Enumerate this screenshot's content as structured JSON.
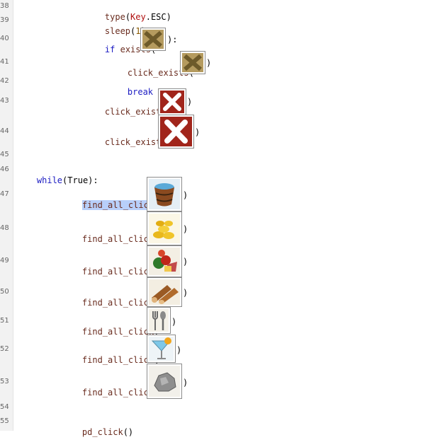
{
  "lines": [
    {
      "n": "38"
    },
    {
      "n": "39"
    },
    {
      "n": "40"
    },
    {
      "n": "41"
    },
    {
      "n": "42"
    },
    {
      "n": "43"
    },
    {
      "n": "44"
    },
    {
      "n": "45"
    },
    {
      "n": "46"
    },
    {
      "n": "47"
    },
    {
      "n": "48"
    },
    {
      "n": "49"
    },
    {
      "n": "50"
    },
    {
      "n": "51"
    },
    {
      "n": "52"
    },
    {
      "n": "53"
    },
    {
      "n": "54"
    },
    {
      "n": "55"
    }
  ],
  "code": {
    "l38": {
      "fn": "type",
      "arg1": "Key",
      "arg2": ".ESC"
    },
    "l39": {
      "fn": "sleep",
      "arg": "1"
    },
    "l40": {
      "kw": "if",
      "fn": "exists"
    },
    "l41": {
      "fn": "click_exists"
    },
    "l42": {
      "kw": "break"
    },
    "l43": {
      "fn": "click_exists"
    },
    "l44": {
      "fn": "click_exists"
    },
    "l46": {
      "kw": "while",
      "arg": "True"
    },
    "l47": {
      "fn": "find_all_click"
    },
    "l48": {
      "fn": "find_all_click"
    },
    "l49": {
      "fn": "find_all_click"
    },
    "l50": {
      "fn": "find_all_click"
    },
    "l51": {
      "fn": "find_all_click"
    },
    "l52": {
      "fn": "find_all_click"
    },
    "l53": {
      "fn": "find_all_click"
    },
    "l55": {
      "fn": "pd_click"
    }
  },
  "punct": {
    "open": "(",
    "close": ")",
    "colon": ":",
    "empty_call": "()"
  },
  "icons": {
    "l40": "x-close-dim-icon",
    "l41": "x-close-dim-icon",
    "l43": "x-close-red-icon",
    "l44": "x-close-red-icon",
    "l47": "bucket-icon",
    "l48": "gold-coins-icon",
    "l49": "food-basket-icon",
    "l50": "wood-logs-icon",
    "l51": "fork-spoon-icon",
    "l52": "cocktail-icon",
    "l53": "stone-ore-icon"
  },
  "colors": {
    "keyword": "#1a1ac2",
    "function": "#6a2c1f",
    "selection": "#b8cffa"
  }
}
